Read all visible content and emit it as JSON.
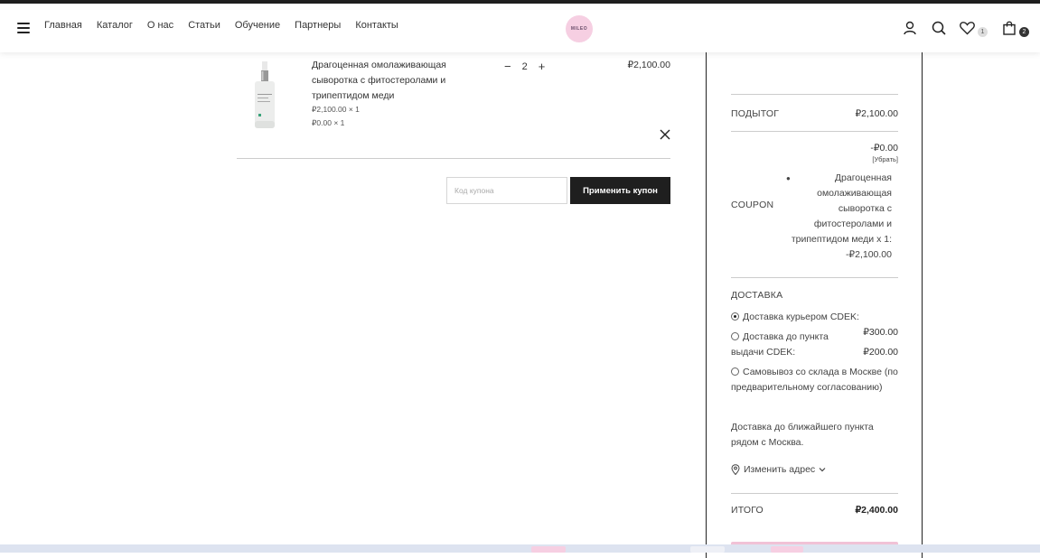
{
  "header": {
    "nav": [
      "Главная",
      "Каталог",
      "О нас",
      "Статьи",
      "Обучение",
      "Партнеры",
      "Контакты"
    ],
    "logo_text": "MILEO",
    "wishlist_count": "1",
    "cart_count": "2"
  },
  "cart": {
    "item": {
      "name": "Драгоценная омолаживающая сыворотка с фитостеролами и трипептидом меди",
      "line1": "₽2,100.00 × 1",
      "line2": "₽0.00 × 1",
      "quantity": "2",
      "minus": "−",
      "plus": "+",
      "price": "₽2,100.00"
    },
    "coupon": {
      "placeholder": "Код купона",
      "apply_label": "Применить купон"
    }
  },
  "totals": {
    "subtotal_label": "ПОДЫТОГ",
    "subtotal_value": "₽2,100.00",
    "coupon_discount": "-₽0.00",
    "coupon_remove": "[Убрать]",
    "coupon_label": "COUPON",
    "coupon_detail": "Драгоценная омолаживающая сыворотка с фитостеролами и трипептидом меди x 1: -₽2,100.00",
    "shipping_label": "ДОСТАВКА",
    "shipping_options": [
      {
        "label": "Доставка курьером CDEK:",
        "price": ""
      },
      {
        "label": "Доставка до пункта выдачи CDEK:",
        "price_a": "₽300.00",
        "price_b": "₽200.00"
      },
      {
        "label": "Самовывоз со склада в Москве (по предварительному согласованию)",
        "price": ""
      }
    ],
    "selected_shipping": 0,
    "shipping_note": "Доставка до ближайшего пункта рядом с Москва.",
    "change_address": "Изменить адрес",
    "total_label": "ИТОГО",
    "total_value": "₽2,400.00"
  },
  "colors": {
    "dark": "#1f1f1f",
    "accent_pink": "#f6cfe2"
  }
}
